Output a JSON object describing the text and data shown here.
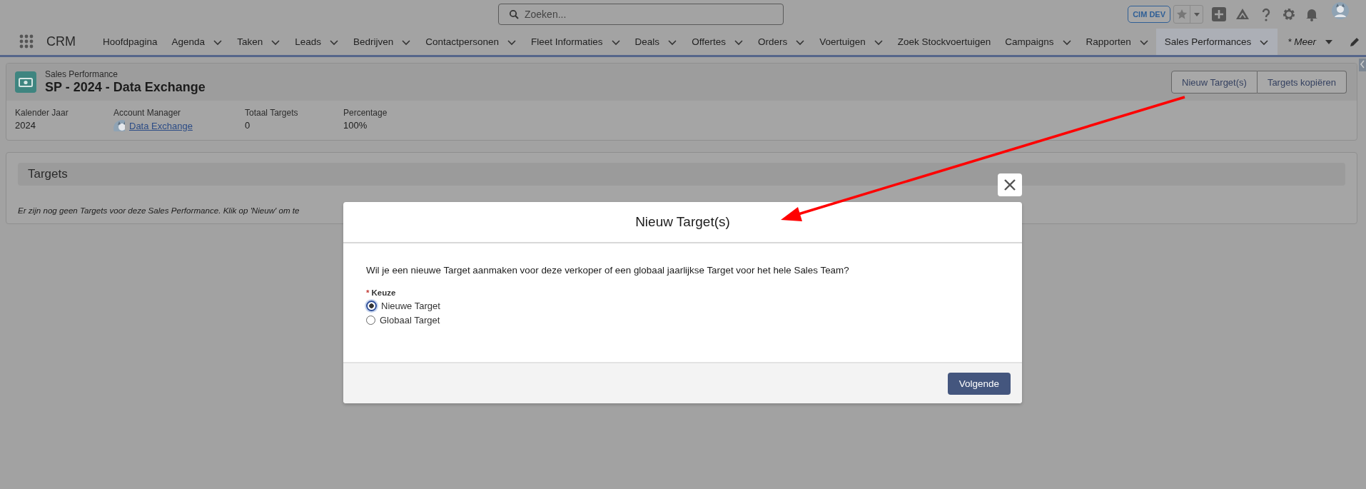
{
  "global_header": {
    "search": {
      "placeholder": "Zoeken..."
    },
    "org_badge": "CIM DEV"
  },
  "nav": {
    "app_name": "CRM",
    "items": [
      {
        "label": "Hoofdpagina",
        "dropdown": false,
        "selected": false
      },
      {
        "label": "Agenda",
        "dropdown": true,
        "selected": false
      },
      {
        "label": "Taken",
        "dropdown": true,
        "selected": false
      },
      {
        "label": "Leads",
        "dropdown": true,
        "selected": false
      },
      {
        "label": "Bedrijven",
        "dropdown": true,
        "selected": false
      },
      {
        "label": "Contactpersonen",
        "dropdown": true,
        "selected": false
      },
      {
        "label": "Fleet Informaties",
        "dropdown": true,
        "selected": false
      },
      {
        "label": "Deals",
        "dropdown": true,
        "selected": false
      },
      {
        "label": "Offertes",
        "dropdown": true,
        "selected": false
      },
      {
        "label": "Orders",
        "dropdown": true,
        "selected": false
      },
      {
        "label": "Voertuigen",
        "dropdown": true,
        "selected": false
      },
      {
        "label": "Zoek Stockvoertuigen",
        "dropdown": false,
        "selected": false
      },
      {
        "label": "Campaigns",
        "dropdown": true,
        "selected": false
      },
      {
        "label": "Rapporten",
        "dropdown": true,
        "selected": false
      },
      {
        "label": "Sales Performances",
        "dropdown": true,
        "selected": true
      }
    ],
    "more": "* Meer"
  },
  "record": {
    "object_label": "Sales Performance",
    "title": "SP - 2024 - Data Exchange",
    "actions": [
      "Nieuw Target(s)",
      "Targets kopiëren"
    ],
    "fields": [
      {
        "label": "Kalender Jaar",
        "value": "2024",
        "kind": "text"
      },
      {
        "label": "Account Manager",
        "value": "Data Exchange",
        "kind": "user_link"
      },
      {
        "label": "Totaal Targets",
        "value": "0",
        "kind": "text"
      },
      {
        "label": "Percentage",
        "value": "100%",
        "kind": "text"
      }
    ]
  },
  "related": {
    "title": "Targets",
    "empty_message": "Er zijn nog geen Targets voor deze Sales Performance. Klik op 'Nieuw' om te"
  },
  "modal": {
    "title": "Nieuw Target(s)",
    "question": "Wil je een nieuwe Target aanmaken voor deze verkoper of een globaal jaarlijkse Target voor het hele Sales Team?",
    "field": {
      "required_mark": "*",
      "label": "Keuze",
      "options": [
        {
          "label": "Nieuwe Target",
          "selected": true
        },
        {
          "label": "Globaal Target",
          "selected": false
        }
      ]
    },
    "buttons": [
      "Volgende"
    ]
  }
}
